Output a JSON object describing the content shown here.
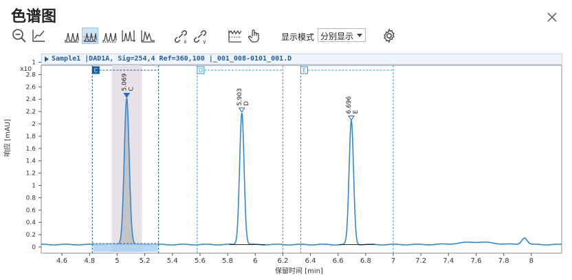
{
  "window": {
    "title": "色谱图"
  },
  "toolbar": {
    "icons": [
      "zoom-out-icon",
      "zoom-axis-icon",
      "peak-view-1-icon",
      "peak-view-2-icon",
      "peak-view-3-icon",
      "peak-view-4-icon",
      "peak-view-5-icon",
      "link-x-icon",
      "link-y-icon",
      "baseline-icon",
      "pan-hand-icon",
      "settings-icon"
    ],
    "display_mode_label": "显示模式",
    "display_mode_value": "分别显示"
  },
  "trace_header": "Sample1 |DAD1A, Sig=254,4 Ref=360,100 |_001_008-0101_001.D",
  "chart_data": {
    "type": "line",
    "xlabel": "保留时间 [min]",
    "ylabel": "响应 [mAU]",
    "y_multiplier": "x10",
    "xlim": [
      4.45,
      8.22
    ],
    "ylim": [
      -0.1,
      2.95
    ],
    "x_ticks": [
      "4.6",
      "4.8",
      "5",
      "5.2",
      "5.4",
      "5.6",
      "5.8",
      "6",
      "6.2",
      "6.4",
      "6.6",
      "6.8",
      "7",
      "7.2",
      "7.4",
      "7.6",
      "7.8",
      "8"
    ],
    "x_tick_values": [
      4.6,
      4.8,
      5.0,
      5.2,
      5.4,
      5.6,
      5.8,
      6.0,
      6.2,
      6.4,
      6.6,
      6.8,
      7.0,
      7.2,
      7.4,
      7.6,
      7.8,
      8.0
    ],
    "y_ticks": [
      "0",
      "0.2",
      "0.4",
      "0.6",
      "0.8",
      "1",
      "1.2",
      "1.4",
      "1.6",
      "1.8",
      "2",
      "2.2",
      "2.4",
      "2.6",
      "2.8",
      "1"
    ],
    "y_tick_values": [
      0,
      0.2,
      0.4,
      0.6,
      0.8,
      1.0,
      1.2,
      1.4,
      1.6,
      1.8,
      2.0,
      2.2,
      2.4,
      2.6,
      2.8,
      3.0
    ],
    "peaks": [
      {
        "rt": 5.069,
        "rt_label": "5.069",
        "name": "C",
        "height": 2.38,
        "width": 0.018,
        "selected": true
      },
      {
        "rt": 5.903,
        "rt_label": "5.903",
        "name": "D",
        "height": 2.14,
        "width": 0.016
      },
      {
        "rt": 6.696,
        "rt_label": "6.696",
        "name": "E",
        "height": 2.01,
        "width": 0.016
      }
    ],
    "windows": [
      {
        "label": "C",
        "x0": 4.82,
        "x1": 5.3,
        "selected": true
      },
      {
        "label": "D",
        "x0": 5.58,
        "x1": 6.2
      },
      {
        "label": "E",
        "x0": 6.33,
        "x1": 7.0
      }
    ],
    "baseline": 0.04,
    "colors": {
      "trace": "#2f86d4",
      "window_selected": "#1a5aa0",
      "window": "#2f9ae0",
      "highlight": "#e7e2e7",
      "baseline_segment": "#222222"
    }
  }
}
